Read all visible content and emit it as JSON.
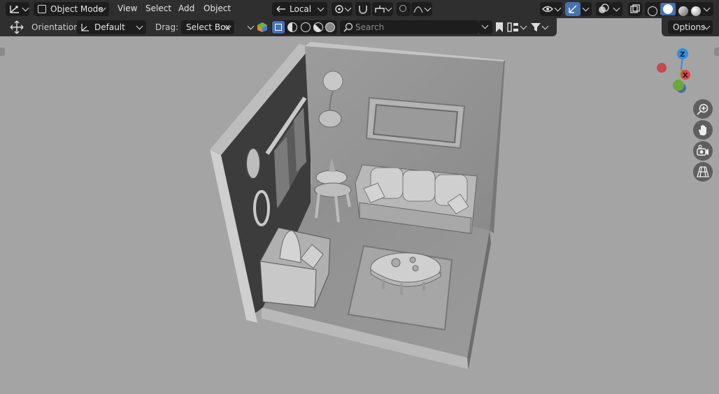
{
  "header": {
    "mode_label": "Object Mode",
    "menus": [
      "View",
      "Select",
      "Add",
      "Object"
    ],
    "transform_orientation": "Local",
    "orientation_label": "Orientation:",
    "orientation_value": "Default",
    "drag_label": "Drag:",
    "drag_value": "Select Box",
    "search_placeholder": "Search",
    "options_label": "Options"
  },
  "gizmo": {
    "z": "Z",
    "x": "X",
    "colors": {
      "x": "#e0444d",
      "y": "#7cc048",
      "z": "#2f8ee6"
    }
  },
  "icons": {
    "editor_type": "view3d-icon",
    "mode": "object-mode-icon",
    "orientation": "transform-orientation-icon",
    "pivot": "pivot-point-icon",
    "snap": "magnet-icon",
    "proportional": "proportional-edit-icon",
    "visibility": "eye-icon",
    "gizmos": "gizmo-icon",
    "overlays": "overlay-icon",
    "xray": "xray-icon",
    "zoom": "zoom-icon",
    "pan": "hand-icon",
    "camera": "camera-icon",
    "perspective": "grid-icon"
  },
  "accent_color": "#4772b3"
}
